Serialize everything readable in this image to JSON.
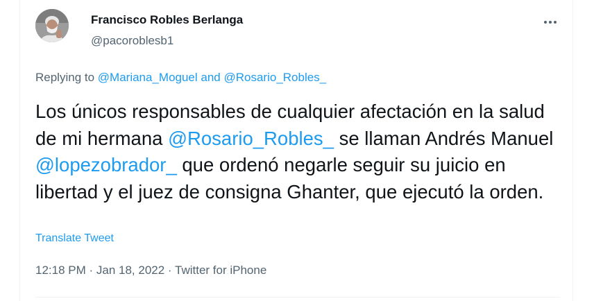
{
  "author": {
    "name": "Francisco Robles Berlanga",
    "handle": "@pacoroblesb1",
    "avatar_icon": "user-avatar-photo"
  },
  "more_icon": "more-dots-icon",
  "replying": {
    "prefix": "Replying to ",
    "user1": "@Mariana_Moguel",
    "conjunction": " and ",
    "user2": "@Rosario_Robles_"
  },
  "tweet": {
    "t1": "Los únicos responsables de cualquier afectación en la salud de mi hermana ",
    "m1": "@Rosario_Robles_",
    "t2": " se llaman Andrés Manuel ",
    "m2": "@lopezobrador_",
    "t3": " que ordenó negarle seguir su juicio en libertad y el juez de consigna Ghanter, que ejecutó la orden."
  },
  "translate_label": "Translate Tweet",
  "meta": {
    "time": "12:18 PM",
    "sep1": " · ",
    "date": "Jan 18, 2022",
    "sep2": " · ",
    "source": "Twitter for iPhone"
  },
  "colors": {
    "link": "#1d9bf0",
    "secondary_text": "#536471",
    "primary_text": "#0f1419"
  }
}
